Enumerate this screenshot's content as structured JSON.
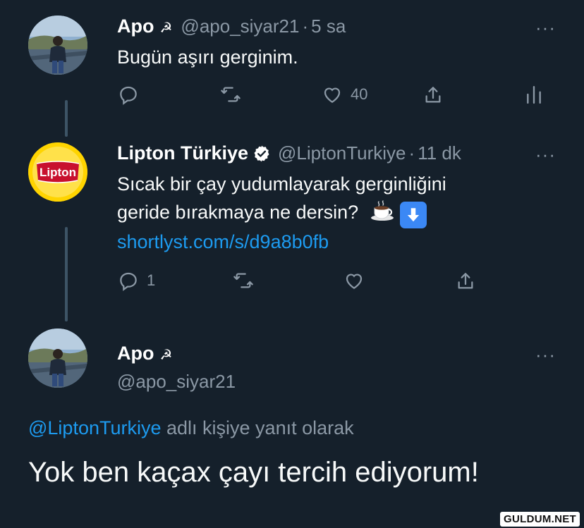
{
  "tweet1": {
    "name": "Apo",
    "emblem": "☭",
    "handle": "@apo_siyar21",
    "separator": "·",
    "time": "5 sa",
    "text": "Bugün aşırı gerginim.",
    "like_count": "40",
    "avatar_icon": "user-photo-avatar"
  },
  "tweet2": {
    "name": "Lipton Türkiye",
    "handle": "@LiptonTurkiye",
    "separator": "·",
    "time": "11 dk",
    "text_line1": "Sıcak bir çay yudumlayarak gerginliğini",
    "text_line2": "geride bırakmaya ne dersin?",
    "link": "shortlyst.com/s/d9a8b0fb",
    "reply_count": "1",
    "logo_text": "Lipton",
    "emoji_1": "hot-beverage-emoji",
    "emoji_2": "down-arrow-emoji"
  },
  "tweet3": {
    "name": "Apo",
    "emblem": "☭",
    "handle": "@apo_siyar21",
    "reply_to_handle": "@LiptonTurkiye",
    "reply_to_suffix": " adlı kişiye yanıt olarak",
    "text": "Yok ben kaçax çayı tercih ediyorum!"
  },
  "more_label": "···",
  "watermark": "GULDUM.NET",
  "colors": {
    "background": "#15202b",
    "secondary_text": "#8b98a5",
    "link": "#1d9bf0",
    "thread_line": "#3d5466",
    "lipton_yellow": "#ffd400",
    "lipton_red": "#c8102e"
  }
}
